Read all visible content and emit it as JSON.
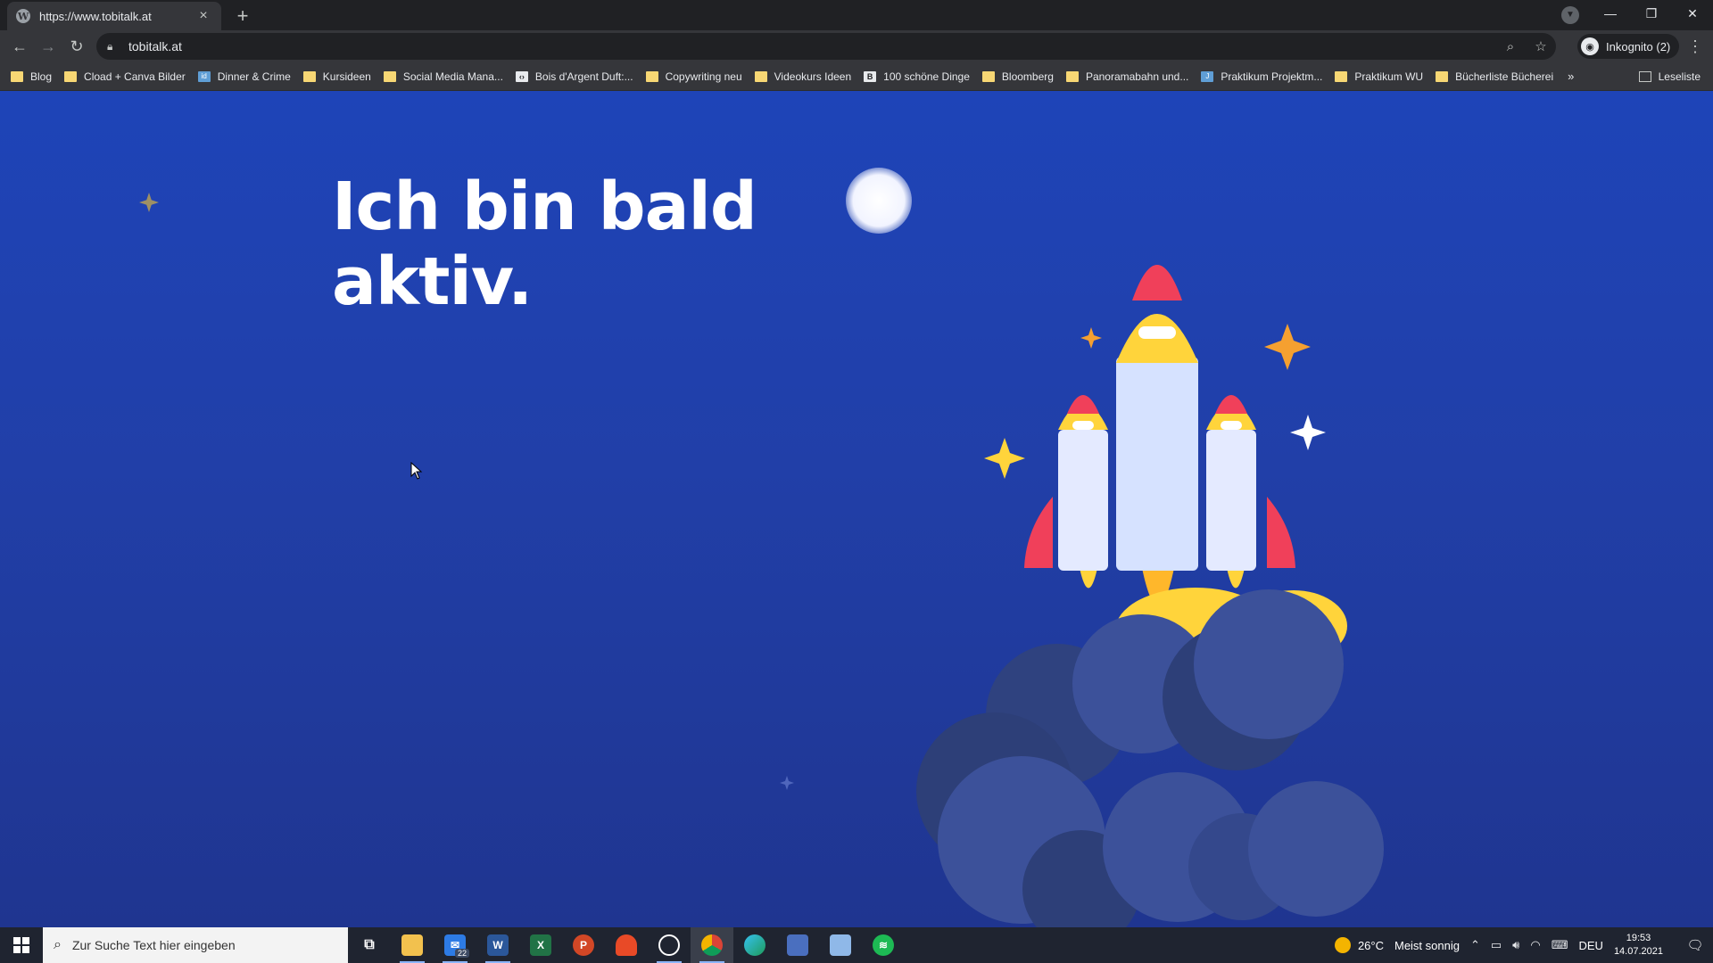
{
  "browser": {
    "tab_title": "https://www.tobitalk.at",
    "url": "tobitalk.at",
    "profile_label": "Inkognito (2)"
  },
  "bookmarks": [
    {
      "label": "Blog",
      "icon": "folder"
    },
    {
      "label": "Cload + Canva Bilder",
      "icon": "folder"
    },
    {
      "label": "Dinner & Crime",
      "icon": "site"
    },
    {
      "label": "Kursideen",
      "icon": "folder"
    },
    {
      "label": "Social Media Mana...",
      "icon": "folder"
    },
    {
      "label": "Bois d'Argent Duft:...",
      "icon": "site"
    },
    {
      "label": "Copywriting neu",
      "icon": "folder"
    },
    {
      "label": "Videokurs Ideen",
      "icon": "folder"
    },
    {
      "label": "100 schöne Dinge",
      "icon": "site"
    },
    {
      "label": "Bloomberg",
      "icon": "folder"
    },
    {
      "label": "Panoramabahn und...",
      "icon": "folder"
    },
    {
      "label": "Praktikum Projektm...",
      "icon": "site"
    },
    {
      "label": "Praktikum WU",
      "icon": "folder"
    },
    {
      "label": "Bücherliste Bücherei",
      "icon": "folder"
    }
  ],
  "reading_list_label": "Leseliste",
  "page": {
    "headline_line1": "Ich bin bald",
    "headline_line2": "aktiv."
  },
  "colors": {
    "background_top": "#1e44b8",
    "background_bottom": "#1f3590",
    "rocket_red": "#f0405a",
    "rocket_yellow": "#ffd43b",
    "cloud": "#3c519a"
  },
  "taskbar": {
    "search_placeholder": "Zur Suche Text hier eingeben",
    "mail_badge": "22",
    "weather_temp": "26°C",
    "weather_text": "Meist sonnig",
    "language": "DEU",
    "time": "19:53",
    "date": "14.07.2021"
  }
}
